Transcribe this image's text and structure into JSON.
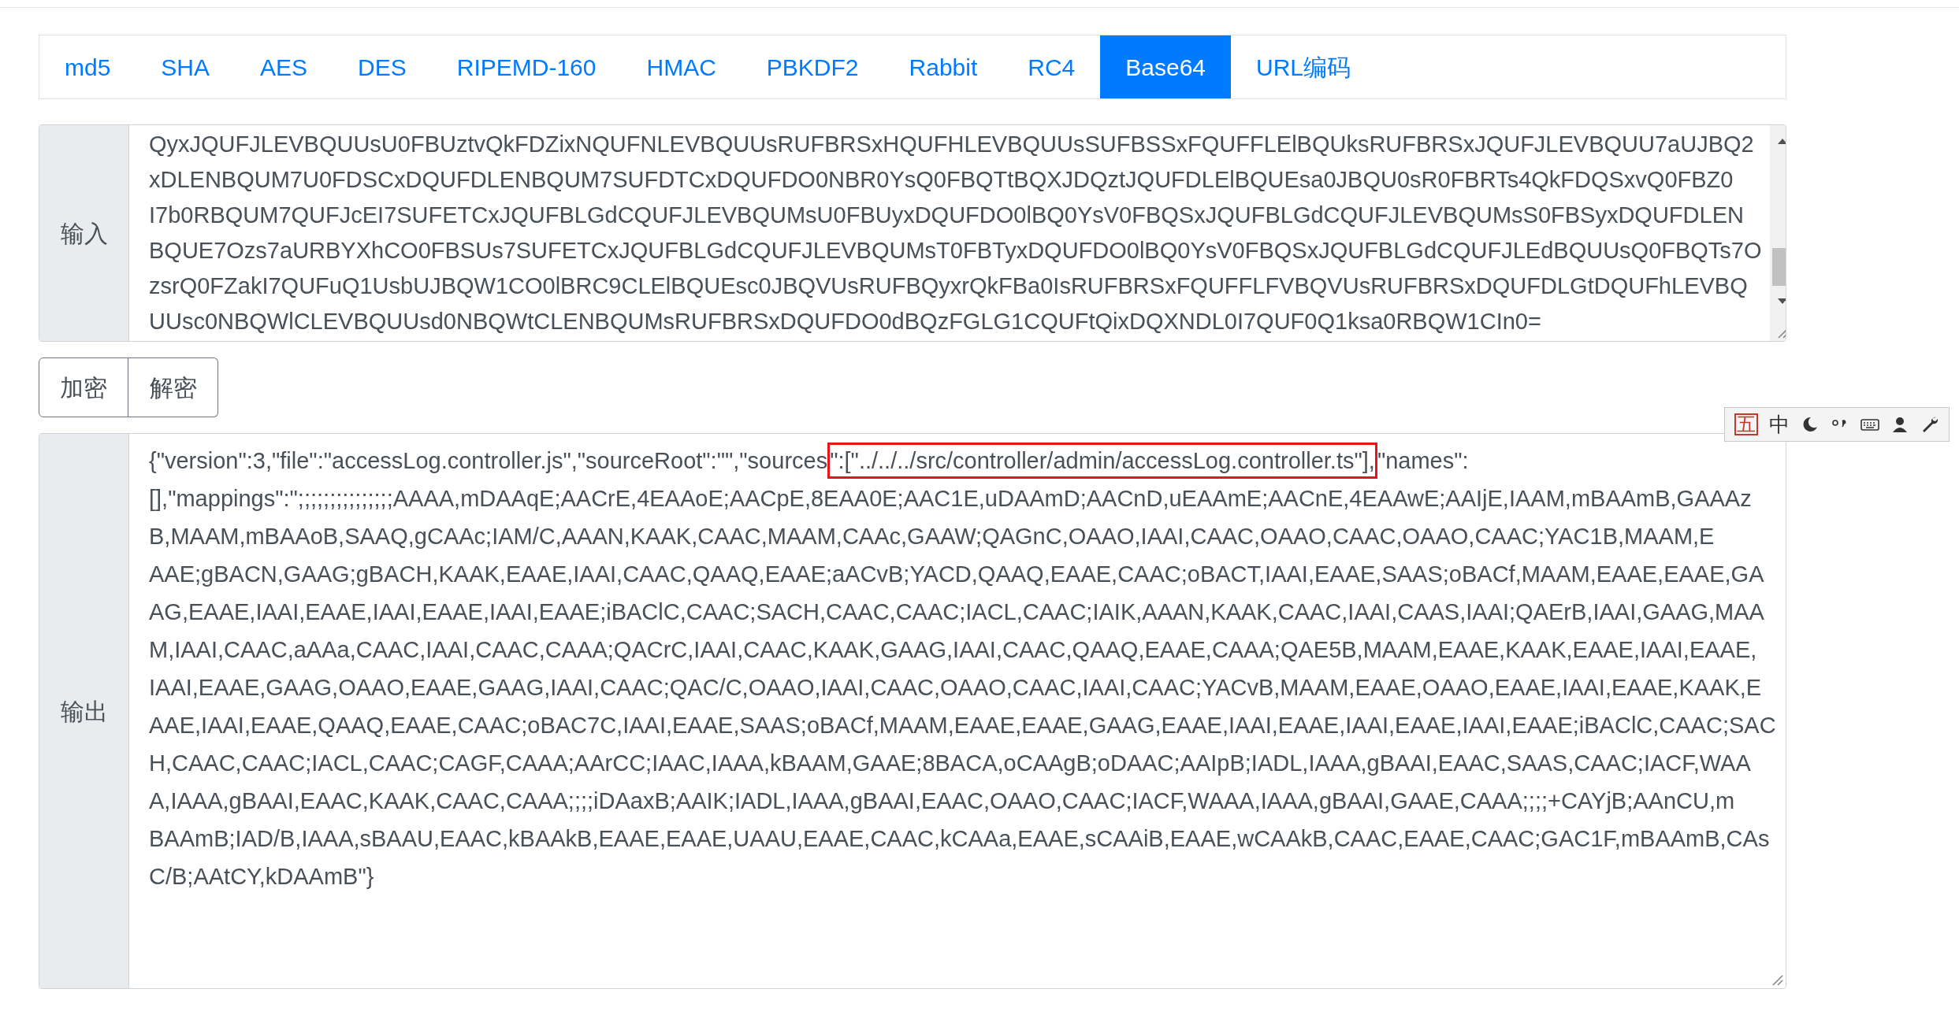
{
  "tabs": [
    {
      "label": "md5",
      "selected": false
    },
    {
      "label": "SHA",
      "selected": false
    },
    {
      "label": "AES",
      "selected": false
    },
    {
      "label": "DES",
      "selected": false
    },
    {
      "label": "RIPEMD-160",
      "selected": false
    },
    {
      "label": "HMAC",
      "selected": false
    },
    {
      "label": "PBKDF2",
      "selected": false
    },
    {
      "label": "Rabbit",
      "selected": false
    },
    {
      "label": "RC4",
      "selected": false
    },
    {
      "label": "Base64",
      "selected": true
    },
    {
      "label": "URL编码",
      "selected": false
    }
  ],
  "input": {
    "label": "输入",
    "lines": [
      "QyxJQUFJLEVBQUUsU0FBUztvQkFDZixNQUFNLEVBQUUsRUFBRSxHQUFHLEVBQUUsSUFBSSxFQUFFLElBQUksRUFBRSxJQUFJLEVBQUU7aUJBQ2",
      "xDLENBQUM7U0FDSCxDQUFDLENBQUM7SUFDTCxDQUFDO0NBR0YsQ0FBQTtBQXJDQztJQUFDLElBQUEsa0JBQU0sR0FBRTs4QkFDQSxvQ0FBZ0",
      "I7b0RBQUM7QUFJcEI7SUFETCxJQUFBLGdCQUFJLEVBQUMsU0FBUyxDQUFDO0lBQ0YsV0FBQSxJQUFBLGdCQUFJLEVBQUMsS0FBSyxDQUFDLEN",
      "BQUE7Ozs7aURBYXhCO0FBSUs7SUFETCxJQUFBLGdCQUFJLEVBQUMsT0FBTyxDQUFDO0lBQ0YsV0FBQSxJQUFBLGdCQUFJLEdBQUUsQ0FBQTs7O",
      "zsrQ0FZakI7QUFuQ1UsbUJBQW1CO0lBRC9CLElBQUEsc0JBQVUsRUFBQyxrQkFBa0IsRUFBRSxFQUFFLFVBQVUsRUFBRSxDQUFDLGtDQUFhLEVBQ",
      "UUsc0NBQWlCLEVBQUUsd0NBQWtCLENBQUMsRUFBRSxDQUFDO0dBQzFGLG1CQUFtQixDQXNDL0I7QUF0Q1ksa0RBQW1CIn0="
    ]
  },
  "buttons": [
    {
      "label": "加密"
    },
    {
      "label": "解密"
    }
  ],
  "ime_toolbar": [
    {
      "kind": "glyph",
      "text": "五"
    },
    {
      "kind": "glyph",
      "text": "中"
    },
    {
      "kind": "moon"
    },
    {
      "kind": "punct"
    },
    {
      "kind": "keyboard"
    },
    {
      "kind": "user"
    },
    {
      "kind": "wrench"
    }
  ],
  "output": {
    "label": "输出",
    "lines": [
      [
        {
          "text": "{\"version\":3,\"file\":\"accessLog.controller.js\",\"sourceRoot\":\"\",\"sources",
          "marked": false
        },
        {
          "text": "\":[\"../../../src/controller/admin/accessLog.controller.ts\"],",
          "marked": true
        },
        {
          "text": "\"names\":",
          "marked": false
        }
      ],
      [
        {
          "text": "[],\"mappings\":\";;;;;;;;;;;;;;;AAAA,mDAAqE;AACrE,4EAAoE;AACpE,8EAA0E;AAC1E,uDAAmD;AACnD,uEAAmE;AACnE,4EAAwE;AAIjE,IAAM,mBAAmB,GAAAz",
          "marked": false
        }
      ],
      [
        {
          "text": "B,MAAM,mBAAoB,SAAQ,gCAAc;IAM/C,AAAN,KAAK,CAAC,MAAM,CAAc,GAAW;QAGnC,OAAO,IAAI,CAAC,OAAO,CAAC,OAAO,CAAC;YAC1B,MAAM,E",
          "marked": false
        }
      ],
      [
        {
          "text": "AAE;gBACN,GAAG;gBACH,KAAK,EAAE,IAAI,CAAC,QAAQ,EAAE;aACvB;YACD,QAAQ,EAAE,CAAC;oBACT,IAAI,EAAE,SAAS;oBACf,MAAM,EAAE,EAAE,GA",
          "marked": false
        }
      ],
      [
        {
          "text": "AG,EAAE,IAAI,EAAE,IAAI,EAAE,IAAI,EAAE;iBAClC,CAAC;SACH,CAAC,CAAC;IACL,CAAC;IAIK,AAAN,KAAK,CAAC,IAAI,CAAS,IAAI;QAErB,IAAI,GAAG,MAA",
          "marked": false
        }
      ],
      [
        {
          "text": "M,IAAI,CAAC,aAAa,CAAC,IAAI,CAAC,CAAA;QACrC,IAAI,CAAC,KAAK,GAAG,IAAI,CAAC,QAAQ,EAAE,CAAA;QAE5B,MAAM,EAAE,KAAK,EAAE,IAAI,EAAE,",
          "marked": false
        }
      ],
      [
        {
          "text": "IAAI,EAAE,GAAG,OAAO,EAAE,GAAG,IAAI,CAAC;QAC/C,OAAO,IAAI,CAAC,OAAO,CAAC,IAAI,CAAC;YACvB,MAAM,EAAE,OAAO,EAAE,IAAI,EAAE,KAAK,E",
          "marked": false
        }
      ],
      [
        {
          "text": "AAE,IAAI,EAAE,QAAQ,EAAE,CAAC;oBAC7C,IAAI,EAAE,SAAS;oBACf,MAAM,EAAE,EAAE,GAAG,EAAE,IAAI,EAAE,IAAI,EAAE,IAAI,EAAE;iBAClC,CAAC;SAC",
          "marked": false
        }
      ],
      [
        {
          "text": "H,CAAC,CAAC;IACL,CAAC;CAGF,CAAA;AArCC;IAAC,IAAA,kBAAM,GAAE;8BACA,oCAAgB;oDAAC;AAIpB;IADL,IAAA,gBAAI,EAAC,SAAS,CAAC;IACF,WAA",
          "marked": false
        }
      ],
      [
        {
          "text": "A,IAAA,gBAAI,EAAC,KAAK,CAAC,CAAA;;;;iDAaxB;AAIK;IADL,IAAA,gBAAI,EAAC,OAAO,CAAC;IACF,WAAA,IAAA,gBAAI,GAAE,CAAA;;;;+CAYjB;AAnCU,m",
          "marked": false
        }
      ],
      [
        {
          "text": "BAAmB;IAD/B,IAAA,sBAAU,EAAC,kBAAkB,EAAE,EAAE,UAAU,EAAE,CAAC,kCAAa,EAAE,sCAAiB,EAAE,wCAAkB,CAAC,EAAE,CAAC;GAC1F,mBAAmB,CAs",
          "marked": false
        }
      ],
      [
        {
          "text": "C/B;AAtCY,kDAAmB\"}",
          "marked": false
        }
      ]
    ]
  }
}
